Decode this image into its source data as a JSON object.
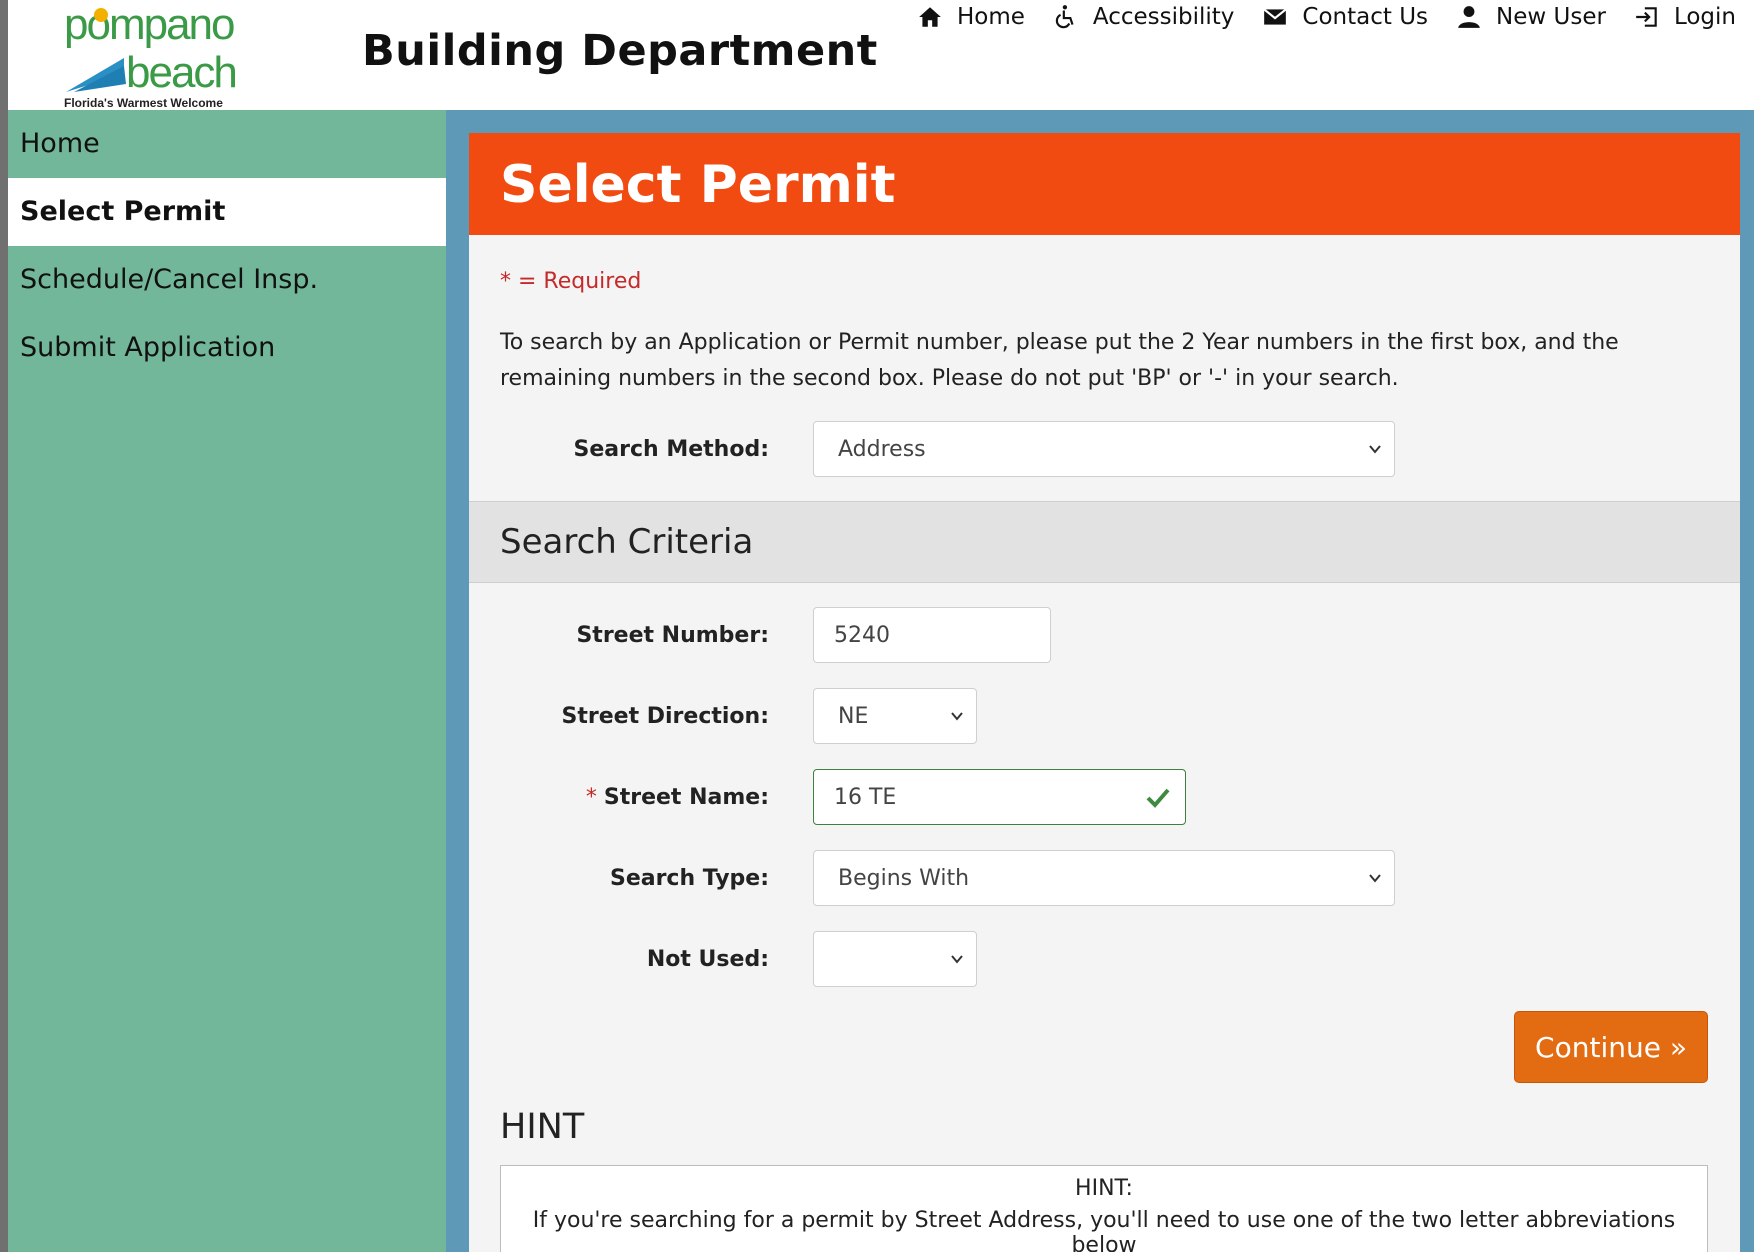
{
  "logo": {
    "line1": "pompano",
    "line2": "beach",
    "tagline": "Florida's Warmest Welcome"
  },
  "header": {
    "title": "Building Department"
  },
  "topnav": [
    {
      "label": "Home",
      "icon": "home-icon"
    },
    {
      "label": "Accessibility",
      "icon": "accessibility-icon"
    },
    {
      "label": "Contact Us",
      "icon": "envelope-icon"
    },
    {
      "label": "New User",
      "icon": "user-icon"
    },
    {
      "label": "Login",
      "icon": "login-icon"
    }
  ],
  "sidebar": {
    "items": [
      {
        "label": "Home",
        "active": false
      },
      {
        "label": "Select Permit",
        "active": true
      },
      {
        "label": "Schedule/Cancel Insp.",
        "active": false
      },
      {
        "label": "Submit Application",
        "active": false
      }
    ]
  },
  "panel": {
    "title": "Select Permit",
    "required_note": "* = Required",
    "instructions": "To search by an Application or Permit number, please put the 2 Year numbers in the first box, and the remaining numbers in the second box. Please do not put 'BP' or '-' in your search.",
    "search_method_label": "Search Method:",
    "search_method_value": "Address"
  },
  "criteria": {
    "section_title": "Search Criteria",
    "street_number_label": "Street Number:",
    "street_number_value": "5240",
    "street_direction_label": "Street Direction:",
    "street_direction_value": "NE",
    "street_name_label": "Street Name:",
    "street_name_value": "16 TE",
    "search_type_label": "Search Type:",
    "search_type_value": "Begins With",
    "not_used_label": "Not Used:",
    "not_used_value": ""
  },
  "actions": {
    "continue_label": "Continue »"
  },
  "hint": {
    "heading": "HINT",
    "box_title": "HINT:",
    "box_text": "If you're searching for a permit by Street Address, you'll need to use one of the two letter abbreviations below"
  },
  "colors": {
    "sidebar": "#73b79a",
    "main_bg": "#5e99b8",
    "panel_header": "#f24b12",
    "continue_button": "#e36b12",
    "required": "#c42a2a"
  }
}
